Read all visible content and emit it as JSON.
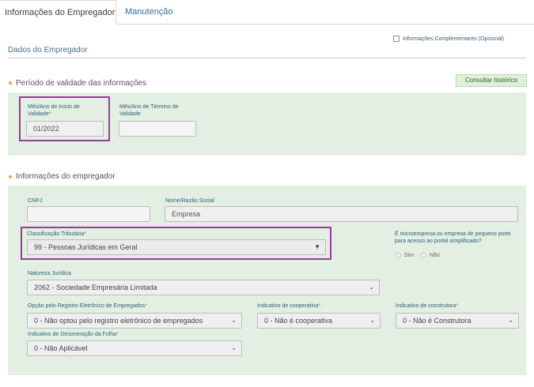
{
  "tabs": {
    "active": "Informações do Empregador",
    "other": "Manutenção"
  },
  "header": {
    "section_title": "Dados do Empregador",
    "complementary_label": "Informações Complementares (Opcional)"
  },
  "validity": {
    "title": "Período de validade das informações",
    "history_button": "Consultar histórico",
    "start_label": "Mês/Ano de Início de Validade",
    "start_value": "01/2022",
    "end_label": "Mês/Ano de Término de Validade",
    "end_value": ""
  },
  "employer": {
    "title": "Informações do empregador",
    "cnpj_label": "CNPJ",
    "cnpj_value": "",
    "name_label": "Nome/Razão Social",
    "name_value": "Empresa",
    "tax_class_label": "Classificação Tributária",
    "tax_class_value": "99 - Pessoas Jurídicas em Geral",
    "micro_question": "É microempresa ou empresa de pequeno porte para acesso ao portal simplificado?",
    "micro_yes": "Sim",
    "micro_no": "Não",
    "legal_nature_label": "Natureza Jurídica",
    "legal_nature_value": "2062 - Sociedade Empresária Limitada",
    "electronic_reg_label": "Opção pelo Registro Eletrônico de Empregados",
    "electronic_reg_value": "0 - Não optou pelo registro eletrônico de empregados",
    "coop_label": "Indicativo de cooperativa",
    "coop_value": "0 - Não é cooperativa",
    "builder_label": "Indicativo de construtora",
    "builder_value": "0 - Não é Construtora",
    "payroll_label": "Indicativo de Desoneração da Folha",
    "payroll_value": "0 - Não Aplicável",
    "required_mark": "*"
  },
  "colors": {
    "panel": "#e3efe2",
    "highlight": "#9a3a9a",
    "bullet": "#f0a830",
    "required": "#d9534f"
  }
}
